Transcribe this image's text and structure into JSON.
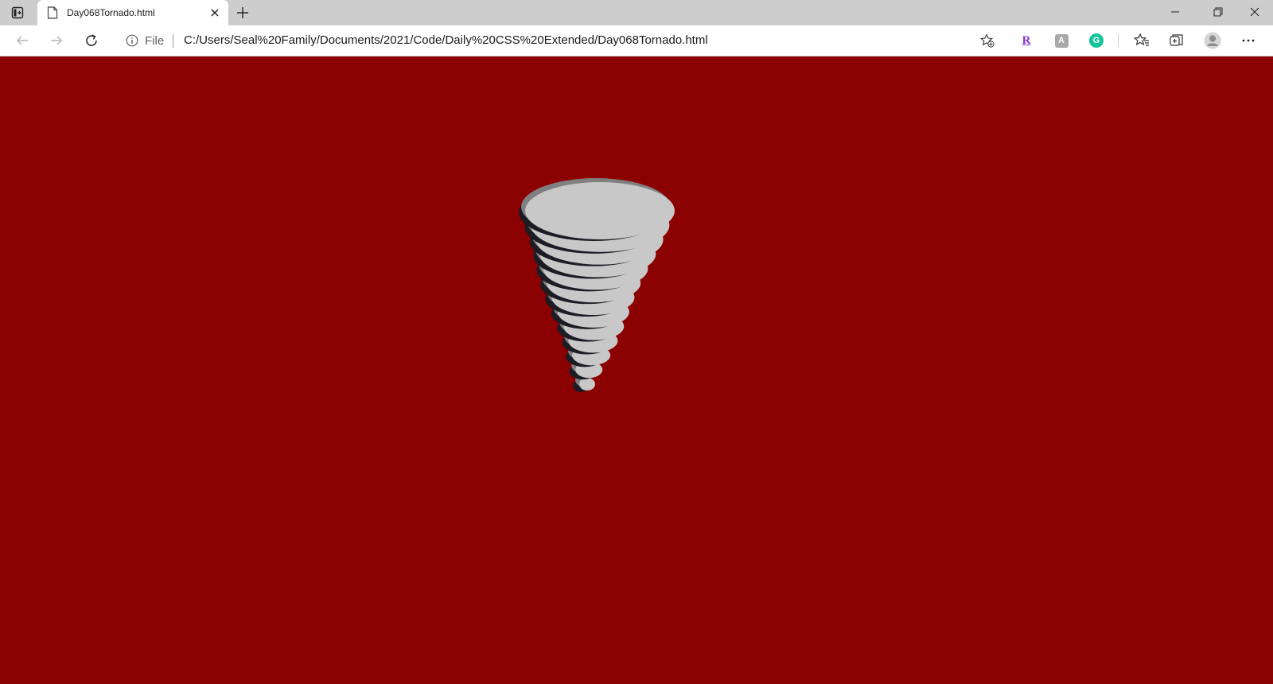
{
  "browser": {
    "tab": {
      "title": "Day068Tornado.html"
    },
    "address_bar": {
      "scheme_label": "File",
      "url": "C:/Users/Seal%20Family/Documents/2021/Code/Daily%20CSS%20Extended/Day068Tornado.html"
    },
    "extensions": [
      {
        "name": "r-extension-icon",
        "glyph": "R",
        "color": "#7b2fd0"
      },
      {
        "name": "translate-extension-icon",
        "glyph": "A",
        "color": "#ffffff"
      },
      {
        "name": "grammarly-icon",
        "glyph": "G",
        "color": "#15c39a"
      }
    ],
    "icons": [
      "tab-actions-icon",
      "page-icon",
      "close-icon",
      "new-tab-icon",
      "minimize-icon",
      "restore-icon",
      "window-close-icon",
      "back-icon",
      "forward-icon",
      "refresh-icon",
      "info-icon",
      "add-favorite-icon",
      "favorites-icon",
      "collections-icon",
      "profile-icon",
      "more-icon"
    ]
  },
  "page": {
    "background_color": "#8b0000",
    "tornado_colors": {
      "body": "#c8c8c8",
      "mid": "#808080",
      "shadow": "#1c1c24"
    }
  }
}
